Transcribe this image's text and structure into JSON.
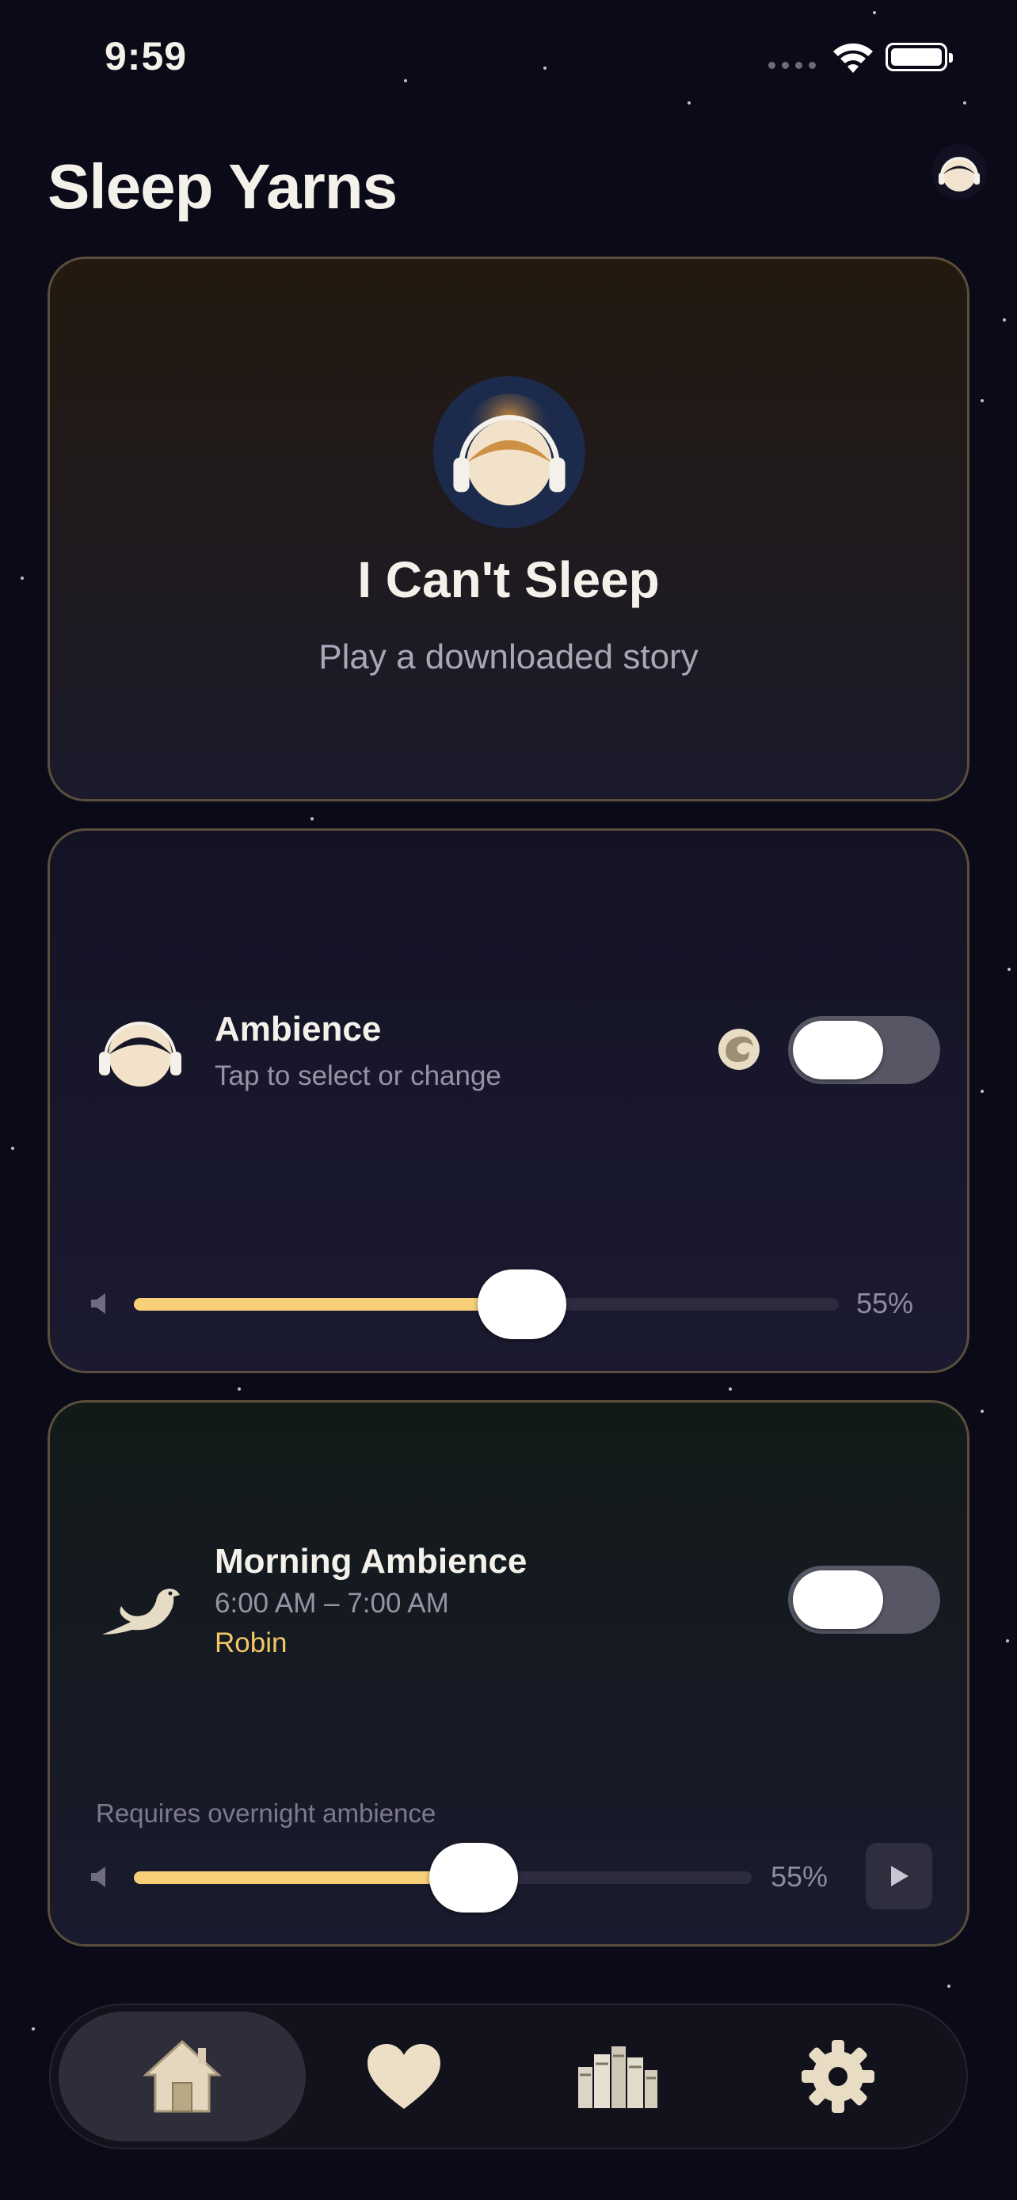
{
  "status_bar": {
    "time": "9:59"
  },
  "header": {
    "title": "Sleep Yarns",
    "profile_icon": "headphones-avatar-icon"
  },
  "sleep_card": {
    "title": "I Can't Sleep",
    "subtitle": "Play a downloaded story",
    "icon": "headphones-avatar-icon"
  },
  "ambience_card": {
    "title": "Ambience",
    "subtitle": "Tap to select or change",
    "toggle_on": true,
    "volume_fraction": 0.55,
    "volume_label": "55%",
    "icon": "headphones-avatar-icon",
    "mode_icon": "wave-icon"
  },
  "morning_card": {
    "title": "Morning Ambience",
    "time_range": "6:00 AM – 7:00 AM",
    "sound_name": "Robin",
    "toggle_on": true,
    "requires_note": "Requires overnight ambience",
    "volume_fraction": 0.55,
    "volume_label": "55%",
    "icon": "bird-icon"
  },
  "tabbar": {
    "tabs": [
      {
        "name": "home",
        "icon": "home-icon",
        "active": true
      },
      {
        "name": "favorites",
        "icon": "heart-icon",
        "active": false
      },
      {
        "name": "library",
        "icon": "books-icon",
        "active": false
      },
      {
        "name": "settings",
        "icon": "gear-icon",
        "active": false
      }
    ]
  },
  "colors": {
    "background": "#0a0a18",
    "accent": "#f6cf78",
    "card_border": "#5a4e3c",
    "highlight_text": "#f3c964"
  }
}
